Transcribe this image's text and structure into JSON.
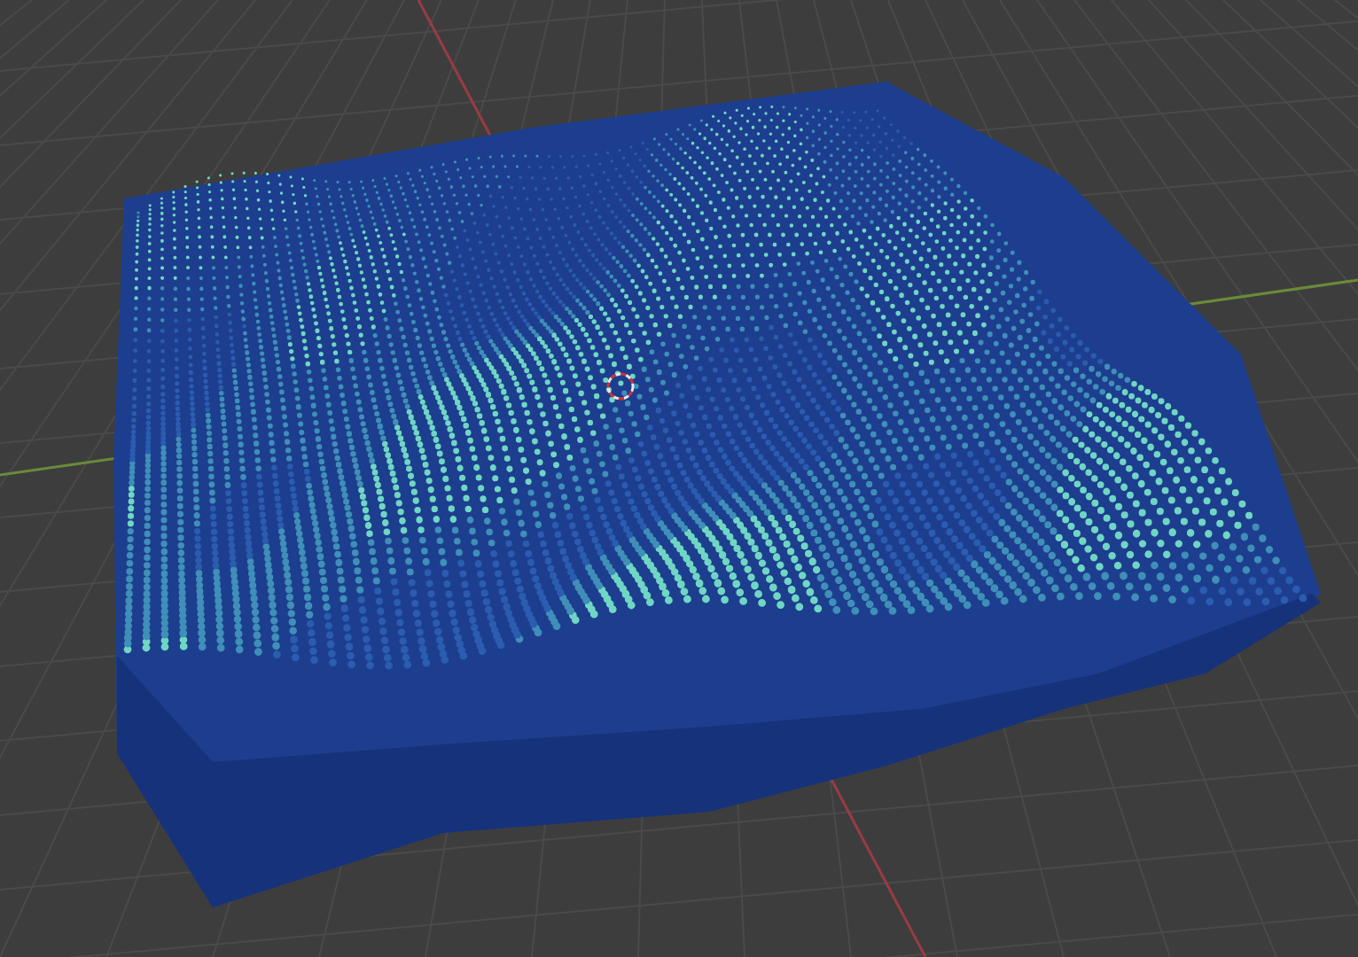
{
  "viewport": {
    "kind": "terrain",
    "show_cursor": true
  }
}
